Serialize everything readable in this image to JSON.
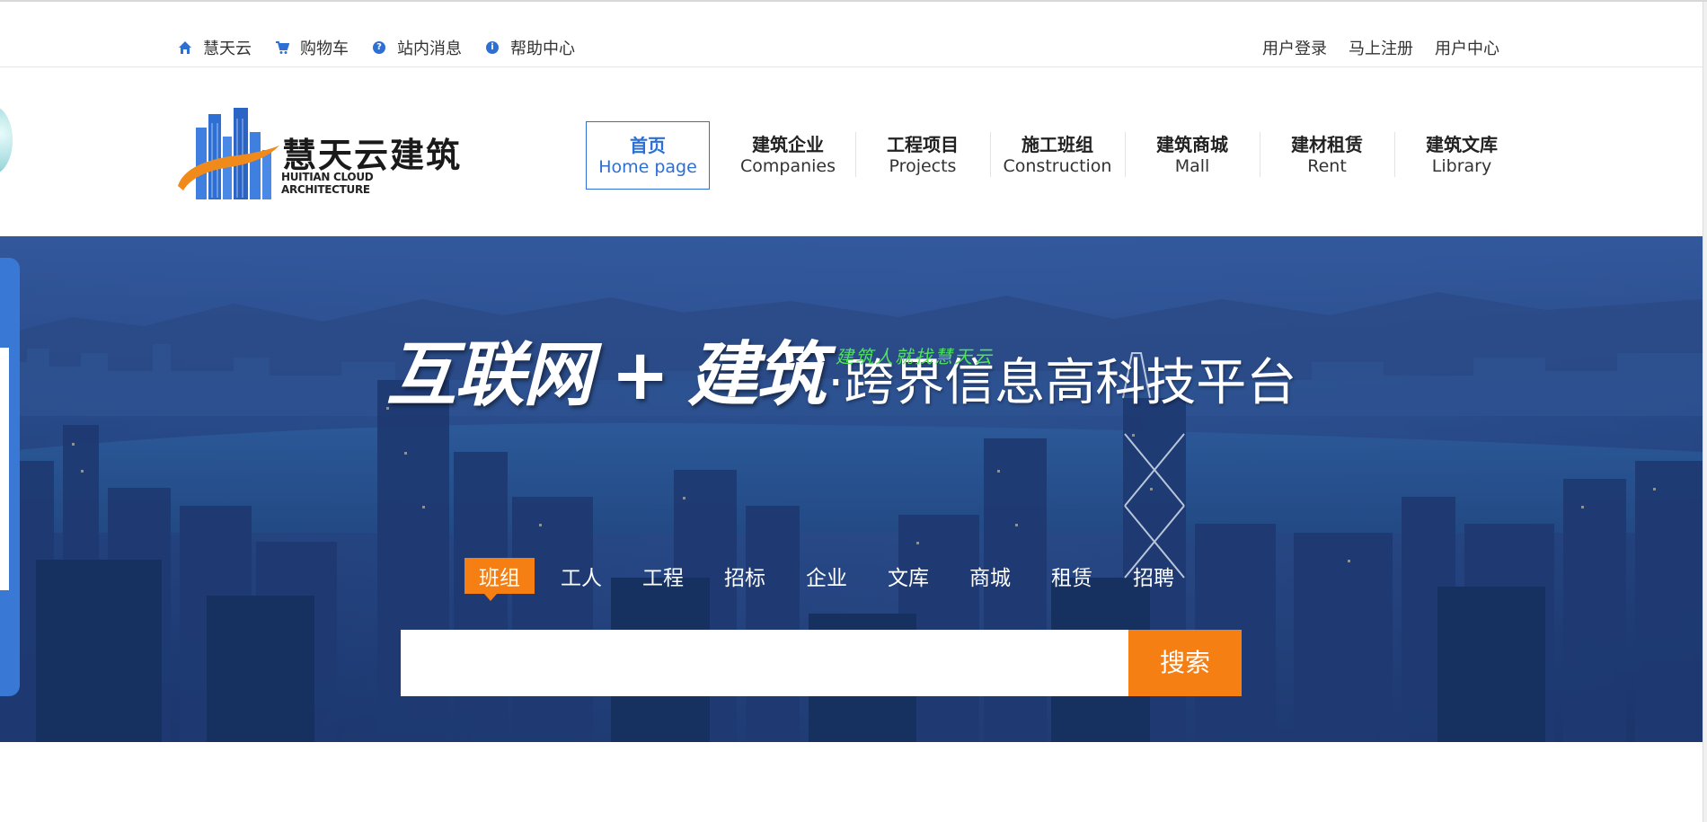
{
  "topbar": {
    "left_items": [
      {
        "label": "慧天云",
        "icon": "home-icon"
      },
      {
        "label": "购物车",
        "icon": "cart-icon"
      },
      {
        "label": "站内消息",
        "icon": "question-icon"
      },
      {
        "label": "帮助中心",
        "icon": "info-icon"
      }
    ],
    "right_items": [
      "用户登录",
      "马上注册",
      "用户中心"
    ]
  },
  "logo": {
    "title": "慧天云建筑",
    "subtitle": "HUITIAN CLOUD ARCHITECTURE"
  },
  "nav": [
    {
      "cn": "首页",
      "en": "Home page",
      "active": true
    },
    {
      "cn": "建筑企业",
      "en": "Companies"
    },
    {
      "cn": "工程项目",
      "en": "Projects"
    },
    {
      "cn": "施工班组",
      "en": "Construction"
    },
    {
      "cn": "建筑商城",
      "en": "Mall"
    },
    {
      "cn": "建材租赁",
      "en": "Rent"
    },
    {
      "cn": "建筑文库",
      "en": "Library"
    }
  ],
  "banner": {
    "headline_part1": "互联网",
    "headline_plus": "+",
    "headline_part2": "建筑",
    "headline_part3": "·跨界信息高科技平台",
    "slogan": "建筑人就找慧天云"
  },
  "search": {
    "tabs": [
      "班组",
      "工人",
      "工程",
      "招标",
      "企业",
      "文库",
      "商城",
      "租赁",
      "招聘"
    ],
    "active_tab": "班组",
    "placeholder": "",
    "button_label": "搜索"
  },
  "colors": {
    "brand_blue": "#2d6fd3",
    "accent_orange": "#f57f12"
  }
}
